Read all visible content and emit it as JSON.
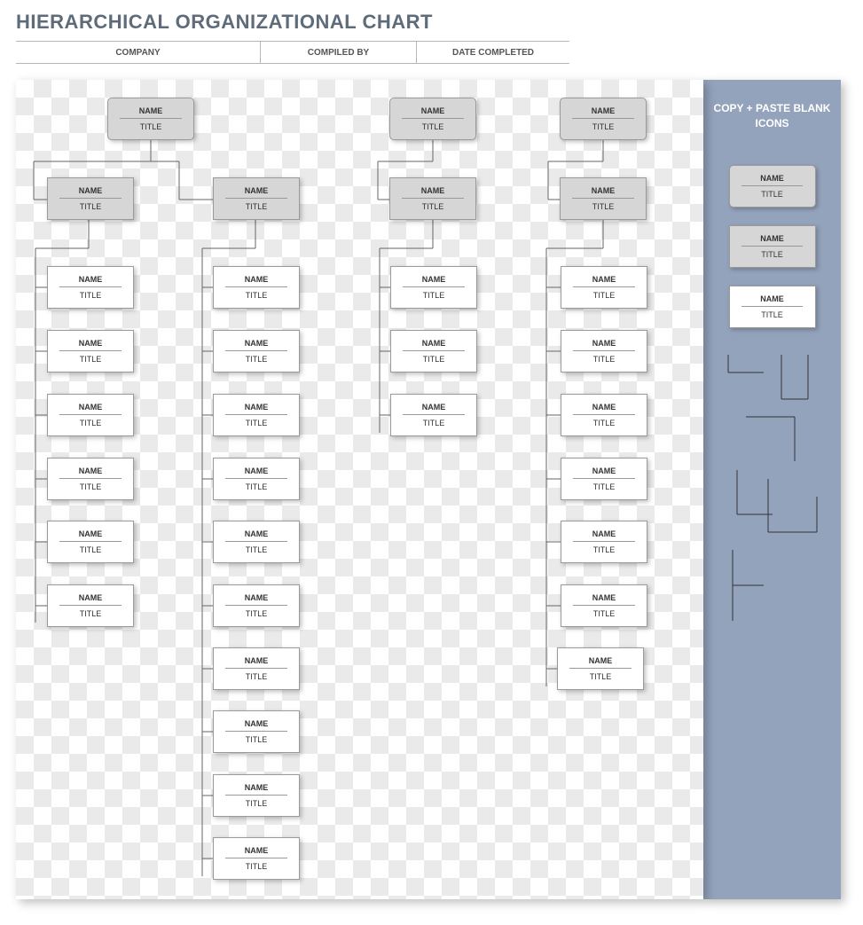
{
  "title": "HIERARCHICAL ORGANIZATIONAL CHART",
  "meta": {
    "company": "COMPANY",
    "compiled_by": "COMPILED BY",
    "date_completed": "DATE COMPLETED"
  },
  "labels": {
    "name": "NAME",
    "title": "TITLE"
  },
  "sidebar_title": "COPY + PASTE BLANK ICONS",
  "tree": {
    "col1_top": {
      "name": "NAME",
      "title": "TITLE"
    },
    "col1_mid_a": {
      "name": "NAME",
      "title": "TITLE"
    },
    "col1_mid_b": {
      "name": "NAME",
      "title": "TITLE"
    },
    "col1_leaf": [
      {
        "name": "NAME",
        "title": "TITLE"
      },
      {
        "name": "NAME",
        "title": "TITLE"
      },
      {
        "name": "NAME",
        "title": "TITLE"
      },
      {
        "name": "NAME",
        "title": "TITLE"
      },
      {
        "name": "NAME",
        "title": "TITLE"
      },
      {
        "name": "NAME",
        "title": "TITLE"
      }
    ],
    "col2_leaf": [
      {
        "name": "NAME",
        "title": "TITLE"
      },
      {
        "name": "NAME",
        "title": "TITLE"
      },
      {
        "name": "NAME",
        "title": "TITLE"
      },
      {
        "name": "NAME",
        "title": "TITLE"
      },
      {
        "name": "NAME",
        "title": "TITLE"
      },
      {
        "name": "NAME",
        "title": "TITLE"
      },
      {
        "name": "NAME",
        "title": "TITLE"
      },
      {
        "name": "NAME",
        "title": "TITLE"
      },
      {
        "name": "NAME",
        "title": "TITLE"
      },
      {
        "name": "NAME",
        "title": "TITLE"
      }
    ],
    "col3_top": {
      "name": "NAME",
      "title": "TITLE"
    },
    "col3_mid": {
      "name": "NAME",
      "title": "TITLE"
    },
    "col3_leaf": [
      {
        "name": "NAME",
        "title": "TITLE"
      },
      {
        "name": "NAME",
        "title": "TITLE"
      },
      {
        "name": "NAME",
        "title": "TITLE"
      }
    ],
    "col4_top": {
      "name": "NAME",
      "title": "TITLE"
    },
    "col4_mid": {
      "name": "NAME",
      "title": "TITLE"
    },
    "col4_leaf": [
      {
        "name": "NAME",
        "title": "TITLE"
      },
      {
        "name": "NAME",
        "title": "TITLE"
      },
      {
        "name": "NAME",
        "title": "TITLE"
      },
      {
        "name": "NAME",
        "title": "TITLE"
      },
      {
        "name": "NAME",
        "title": "TITLE"
      },
      {
        "name": "NAME",
        "title": "TITLE"
      },
      {
        "name": "NAME",
        "title": "TITLE"
      }
    ]
  },
  "sidebar_icons": [
    {
      "style": "round-grey",
      "name": "NAME",
      "title": "TITLE"
    },
    {
      "style": "square-grey",
      "name": "NAME",
      "title": "TITLE"
    },
    {
      "style": "square-white",
      "name": "NAME",
      "title": "TITLE"
    }
  ]
}
